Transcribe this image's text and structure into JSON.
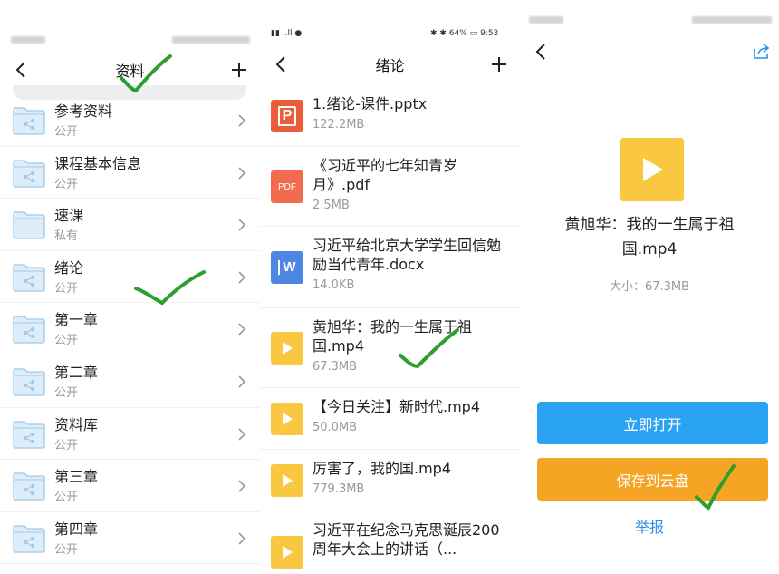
{
  "panel1": {
    "title": "资料",
    "items": [
      {
        "name": "参考资料",
        "sub": "公开",
        "shared": true
      },
      {
        "name": "课程基本信息",
        "sub": "公开",
        "shared": true
      },
      {
        "name": "速课",
        "sub": "私有",
        "shared": false
      },
      {
        "name": "绪论",
        "sub": "公开",
        "shared": true
      },
      {
        "name": "第一章",
        "sub": "公开",
        "shared": true
      },
      {
        "name": "第二章",
        "sub": "公开",
        "shared": true
      },
      {
        "name": "资料库",
        "sub": "公开",
        "shared": true
      },
      {
        "name": "第三章",
        "sub": "公开",
        "shared": true
      },
      {
        "name": "第四章",
        "sub": "公开",
        "shared": true
      }
    ]
  },
  "panel2": {
    "status": {
      "battery": "64%",
      "time": "9:53"
    },
    "title": "绪论",
    "files": [
      {
        "name": "1.绪论-课件.pptx",
        "size": "122.2MB",
        "type": "ppt",
        "icon_label": "P"
      },
      {
        "name": "《习近平的七年知青岁月》.pdf",
        "size": "2.5MB",
        "type": "pdf",
        "icon_label": "PDF"
      },
      {
        "name": "习近平给北京大学学生回信勉励当代青年.docx",
        "size": "14.0KB",
        "type": "word",
        "icon_label": "W"
      },
      {
        "name": "黄旭华：我的一生属于祖国.mp4",
        "size": "67.3MB",
        "type": "video"
      },
      {
        "name": "【今日关注】新时代.mp4",
        "size": "50.0MB",
        "type": "video"
      },
      {
        "name": "厉害了，我的国.mp4",
        "size": "779.3MB",
        "type": "video"
      },
      {
        "name": "习近平在纪念马克思诞辰200周年大会上的讲话（...",
        "size": "",
        "type": "video"
      }
    ]
  },
  "panel3": {
    "file_name": "黄旭华：我的一生属于祖国.mp4",
    "size_label": "大小：67.3MB",
    "open_button": "立即打开",
    "save_button": "保存到云盘",
    "report_link": "举报"
  },
  "colors": {
    "folder": "#9fc9ea",
    "folder_bg": "#ddeefa",
    "ppt": "#ec5b3a",
    "pdf": "#f26b4e",
    "word": "#4e86e4",
    "video": "#f9c740",
    "open": "#2aa3f3",
    "save": "#f5a423",
    "link": "#2a91e6",
    "check": "#2e9e30"
  }
}
